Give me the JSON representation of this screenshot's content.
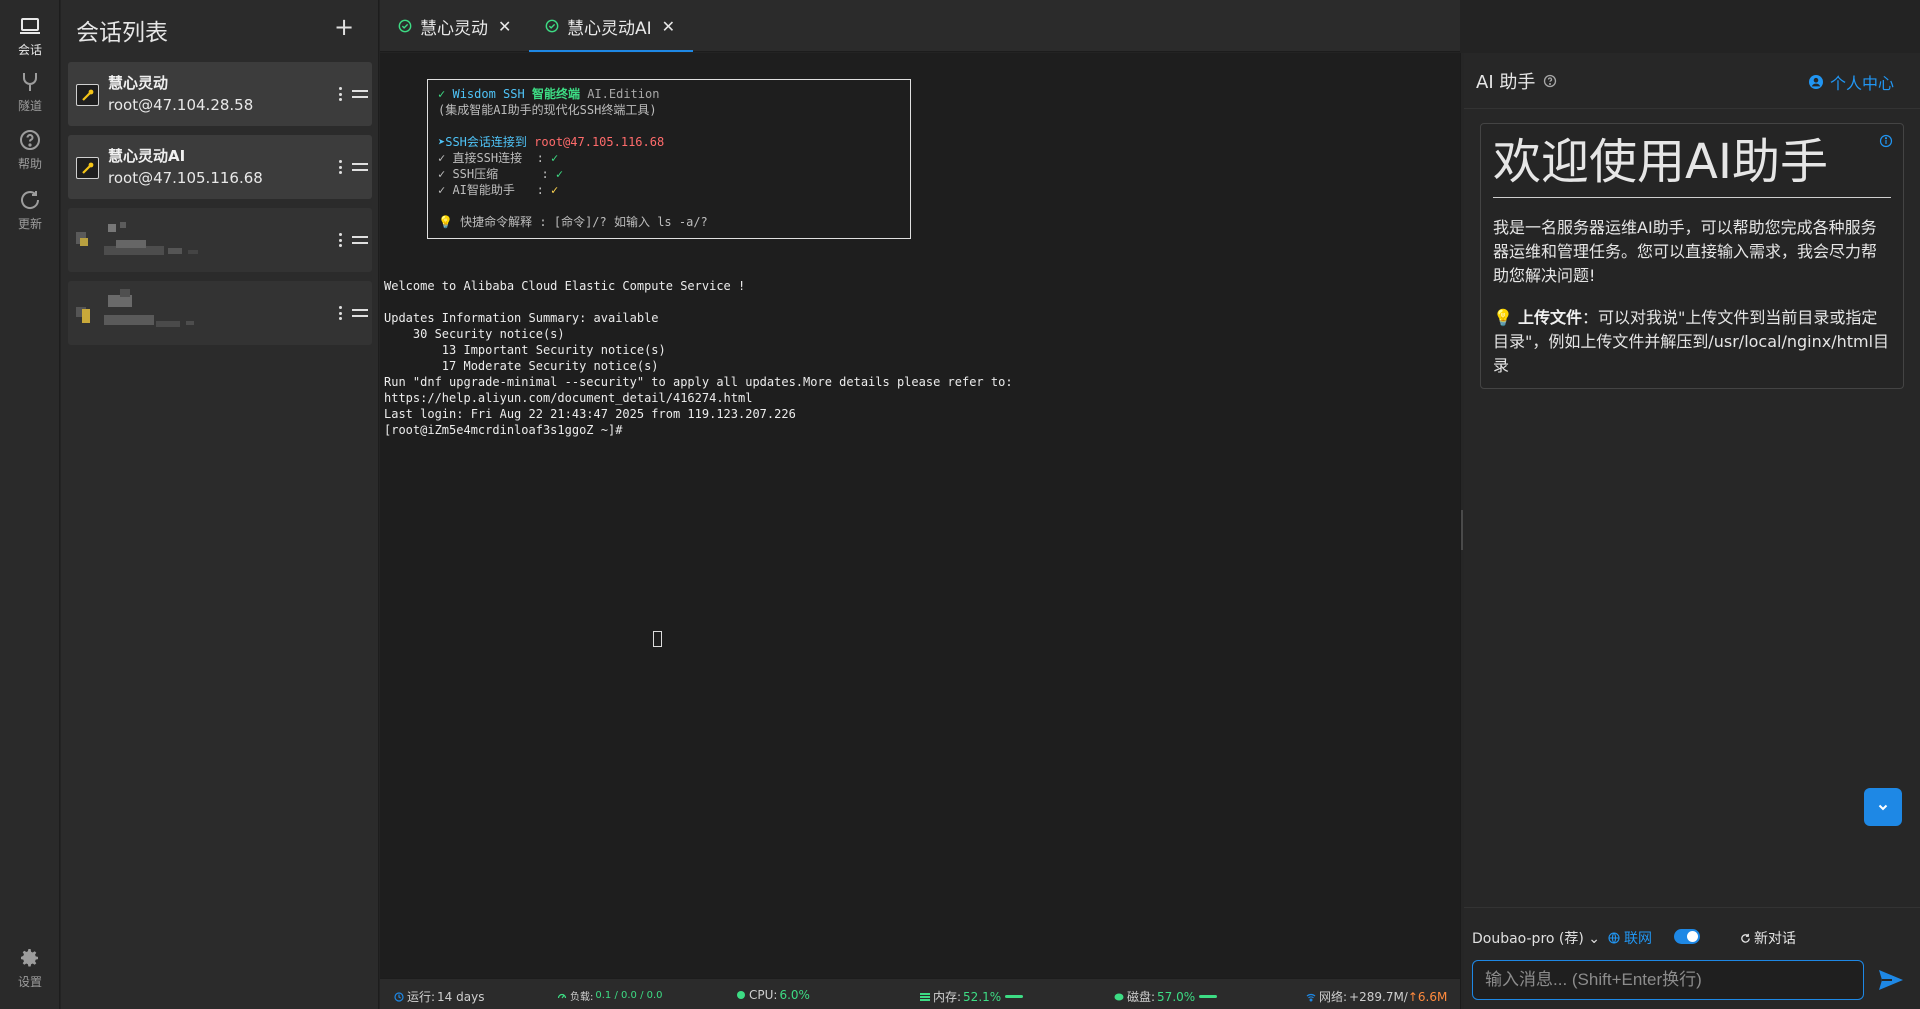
{
  "rail": {
    "items": [
      {
        "label": "会话",
        "icon": "laptop-icon"
      },
      {
        "label": "隧道",
        "icon": "fork-icon"
      },
      {
        "label": "帮助",
        "icon": "help-circle-icon"
      },
      {
        "label": "更新",
        "icon": "refresh-icon"
      }
    ],
    "settings_label": "设置"
  },
  "sessions": {
    "title": "会话列表",
    "add_label": "+",
    "items": [
      {
        "name": "慧心灵动",
        "host": "root@47.104.28.58"
      },
      {
        "name": "慧心灵动AI",
        "host": "root@47.105.116.68"
      }
    ]
  },
  "tabs": [
    {
      "label": "慧心灵动",
      "close": "✕"
    },
    {
      "label": "慧心灵动AI",
      "close": "✕"
    }
  ],
  "terminal": {
    "banner": {
      "title_check": "✓",
      "title_app": "Wisdom SSH",
      "title_cn": "智能终端",
      "title_edition": "AI.Edition",
      "subtitle": "(集成智能AI助手的现代化SSH终端工具)",
      "connect_arrow": "➤",
      "connect_label": "SSH会话连接到",
      "connect_host": "root@47.105.116.68",
      "feature1": "✓ 直接SSH连接  : ",
      "feature2": "✓ SSH压缩      : ",
      "feature3": "✓ AI智能助手   : ",
      "check": "✓",
      "tip_icon": "💡",
      "tip": " 快捷命令解释 : [命令]/? 如输入 ls -a/?"
    },
    "lines": [
      "Welcome to Alibaba Cloud Elastic Compute Service !",
      "",
      "Updates Information Summary: available",
      "    30 Security notice(s)",
      "        13 Important Security notice(s)",
      "        17 Moderate Security notice(s)",
      "Run \"dnf upgrade-minimal --security\" to apply all updates.More details please refer to:",
      "https://help.aliyun.com/document_detail/416274.html",
      "Last login: Fri Aug 22 21:43:47 2025 from 119.123.207.226",
      "[root@iZm5e4mcrdinloaf3s1ggoZ ~]#"
    ]
  },
  "status": {
    "uptime_label": "运行:",
    "uptime_value": "14 days",
    "load_label": "负载:",
    "load_value": "0.1 / 0.0 / 0.0",
    "cpu_label": "CPU:",
    "cpu_value": "6.0%",
    "mem_label": "内存:",
    "mem_value": "52.1%",
    "disk_label": "磁盘:",
    "disk_value": "57.0%",
    "net_label": "网络:",
    "net_down": "+289.7M/",
    "net_up": "↑6.6M"
  },
  "ai": {
    "title": "AI 助手",
    "user_center": "个人中心",
    "welcome_title": "欢迎使用AI助手",
    "welcome_p1": "我是一名服务器运维AI助手，可以帮助您完成各种服务器运维和管理任务。您可以直接输入需求，我会尽力帮助您解决问题!",
    "upload_icon": "💡",
    "upload_label": "上传文件",
    "upload_text": "：可以对我说\"上传文件到当前目录或指定目录\"，例如上传文件并解压到/usr/local/nginx/html目录",
    "model": "Doubao-pro (荐)",
    "net_label": "联网",
    "new_chat": "新对话",
    "input_placeholder": "输入消息... (Shift+Enter换行)"
  },
  "colors": {
    "accent": "#1e88e5",
    "success": "#3ddc84",
    "terminal_bg": "#1e1e1e"
  }
}
